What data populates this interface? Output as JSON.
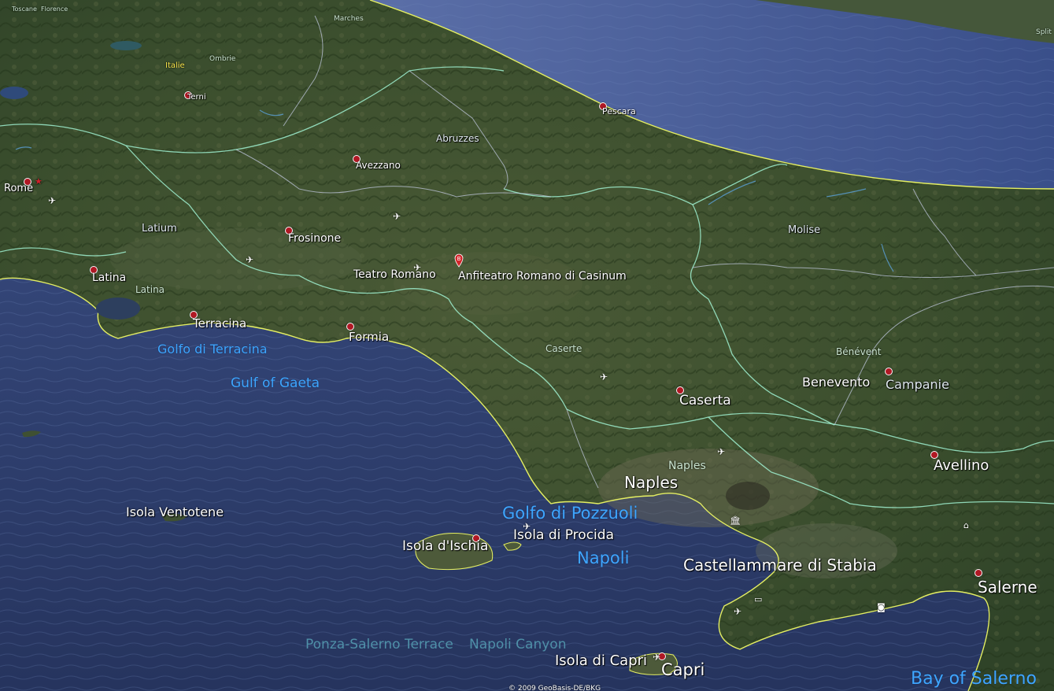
{
  "map": {
    "cities": {
      "rome": "Rome",
      "latina": "Latina",
      "terracina": "Terracina",
      "formia": "Formia",
      "frosinone": "Frosinone",
      "avezzano": "Avezzano",
      "pescara": "Pescara",
      "terni": "Terni",
      "caserta": "Caserta",
      "naples": "Naples",
      "benevento": "Benevento",
      "avellino": "Avellino",
      "salerne": "Salerne",
      "castellammare": "Castellammare di Stabia",
      "capri": "Capri",
      "teatro_romano": "Teatro Romano",
      "anfiteatro": "Anfiteatro Romano di Casinum"
    },
    "regions": {
      "latium": "Latium",
      "latina_prov": "Latina",
      "molise": "Molise",
      "abruzzes": "Abruzzes",
      "caserte": "Caserte",
      "benevent": "Bénévent",
      "campanie": "Campanie",
      "naples_prov": "Naples",
      "ombrie": "Ombrie",
      "marches": "Marches",
      "italie": "Italie",
      "toscane": "Toscane",
      "florence": "Florence",
      "split": "Split"
    },
    "water": {
      "golfo_terracina": "Golfo di Terracina",
      "gulf_gaeta": "Gulf of Gaeta",
      "golfo_pozzuoli": "Golfo di Pozzuoli",
      "napoli": "Napoli",
      "bay_salerno": "Bay of Salerno",
      "ponza_terrace": "Ponza-Salerno Terrace",
      "napoli_canyon": "Napoli Canyon"
    },
    "islands": {
      "ventotene": "Isola Ventotene",
      "ischia": "Isola d'Ischia",
      "procida": "Isola di Procida",
      "capri": "Isola di Capri"
    },
    "placemark_letter": "B",
    "copyright": "© 2009 GeoBasis-DE/BKG",
    "colors": {
      "sea": "#2c3f73",
      "land": "#3d5230",
      "coastline": "#e4ee62",
      "region_border": "#9ff0d0",
      "province_border": "#c7cfe8",
      "city_dot": "#b01824"
    }
  }
}
